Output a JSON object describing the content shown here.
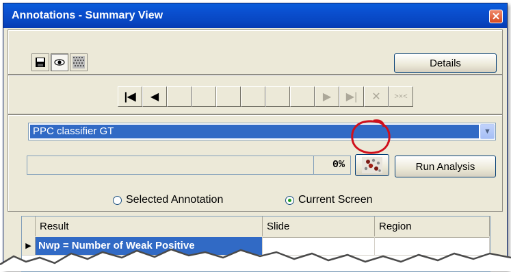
{
  "window": {
    "title": "Annotations - Summary View",
    "close_icon": "close-icon"
  },
  "toolbar": {
    "icons": [
      "save-icon",
      "eye-icon",
      "grid-overlay-icon"
    ],
    "details_label": "Details"
  },
  "navigation": {
    "buttons": [
      "first-record-icon",
      "previous-record-icon",
      "next-record-icon",
      "last-record-icon",
      "delete-icon",
      "cancel-icon"
    ],
    "disabled": [
      "next-record-icon",
      "last-record-icon",
      "delete-icon",
      "cancel-icon"
    ]
  },
  "algorithm_select": {
    "selected": "PPC classifier GT"
  },
  "progress": {
    "fraction": 0.0,
    "percent_text": "0%"
  },
  "run_analysis_label": "Run Analysis",
  "analysis_icon": "analysis-markup-icon",
  "scope": {
    "option_selected_annotation": "Selected Annotation",
    "option_current_screen": "Current Screen",
    "checked": "Current Screen"
  },
  "results_table": {
    "columns": [
      "Result",
      "Slide",
      "Region"
    ],
    "rows": [
      {
        "result": "Nwp = Number of Weak Positive",
        "slide": "",
        "region": ""
      }
    ]
  },
  "colors": {
    "titlebar": "#0a4fcf",
    "selection": "#316ac5",
    "highlight_ring": "#d0101c"
  }
}
